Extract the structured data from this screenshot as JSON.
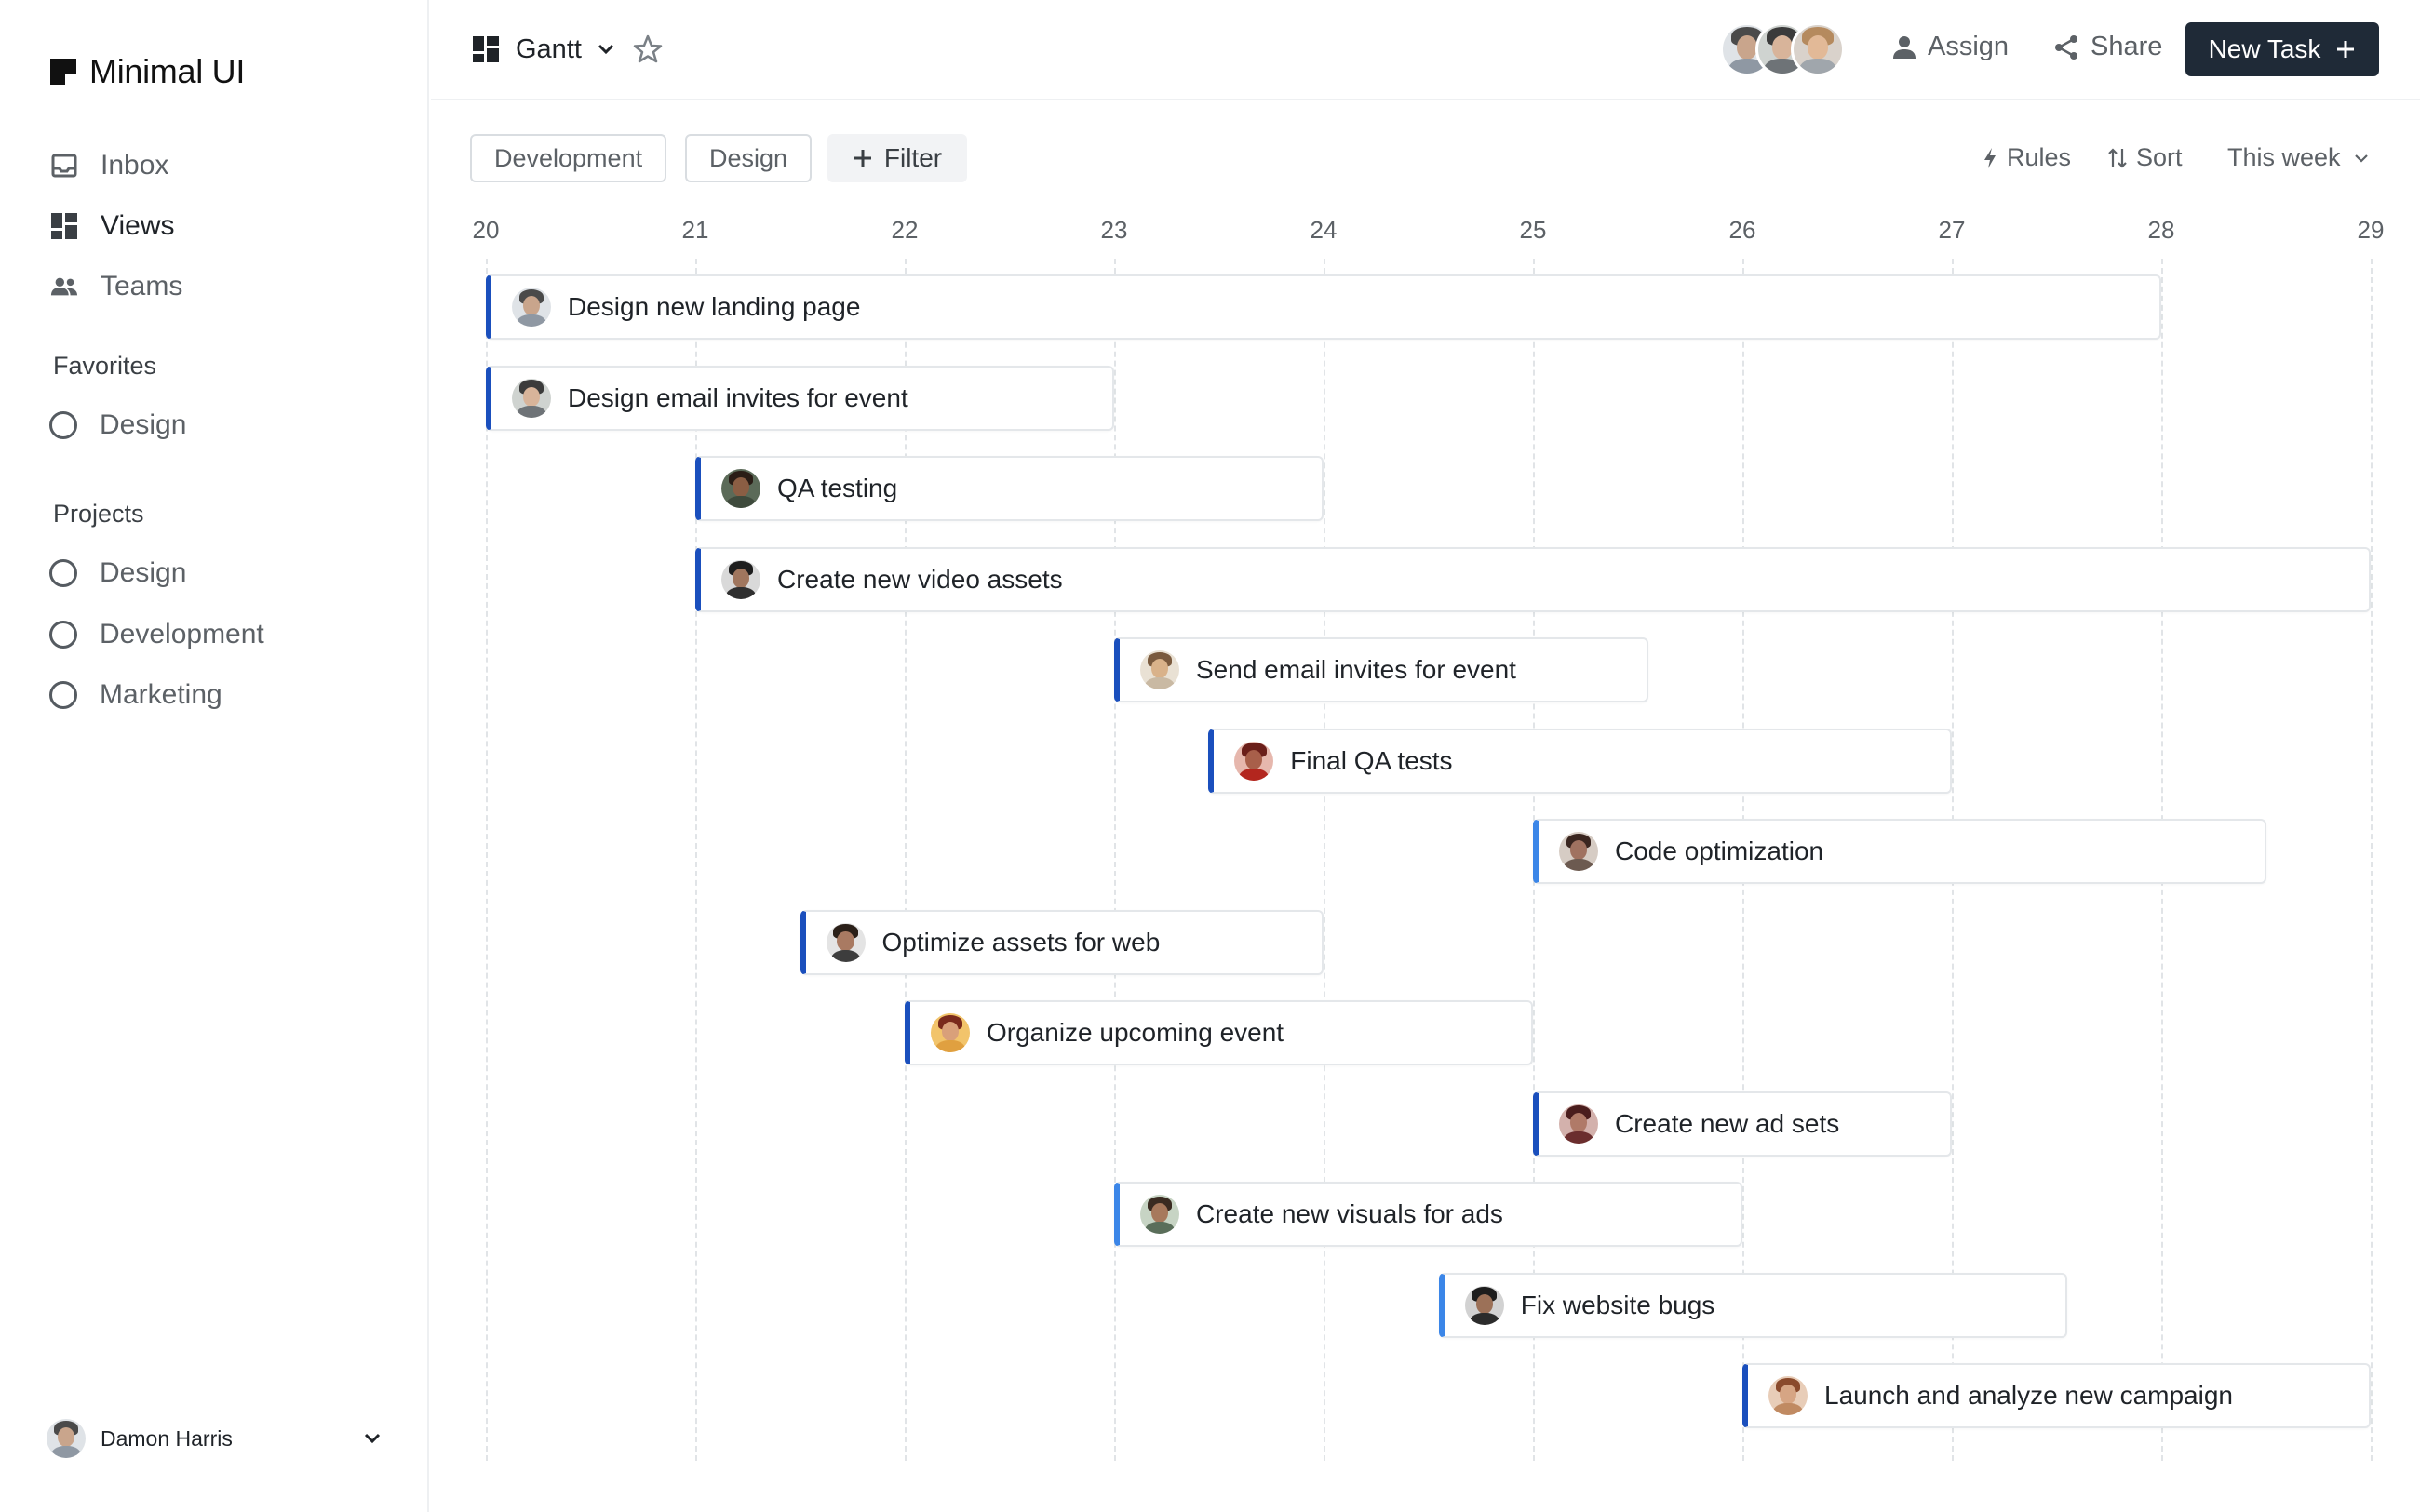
{
  "brand": {
    "name": "Minimal UI"
  },
  "nav": [
    {
      "label": "Inbox",
      "icon": "inbox-icon"
    },
    {
      "label": "Views",
      "icon": "grid-icon"
    },
    {
      "label": "Teams",
      "icon": "people-icon"
    }
  ],
  "favorites": {
    "title": "Favorites",
    "items": [
      {
        "label": "Design"
      }
    ]
  },
  "projects": {
    "title": "Projects",
    "items": [
      {
        "label": "Design"
      },
      {
        "label": "Development"
      },
      {
        "label": "Marketing"
      }
    ]
  },
  "user": {
    "name": "Damon Harris"
  },
  "header": {
    "view_label": "Gantt",
    "assign_label": "Assign",
    "share_label": "Share",
    "new_task_label": "New Task"
  },
  "filters": {
    "chips": [
      "Development",
      "Design"
    ],
    "filter_label": "Filter",
    "rules_label": "Rules",
    "sort_label": "Sort",
    "range_label": "This week"
  },
  "colors": {
    "accent_dark": "#1a4fbd",
    "accent_light": "#3b86e8",
    "button_bg": "#1f2a37"
  },
  "gantt": {
    "days": [
      "20",
      "21",
      "22",
      "23",
      "24",
      "25",
      "26",
      "27",
      "28",
      "29"
    ],
    "tasks": [
      {
        "label": "Design new landing page",
        "start": 0.0,
        "end": 8.0,
        "accent": "dark",
        "avatar": {
          "skin": "#c9a58c",
          "hair": "#4a4a4a",
          "shirt": "#8f98a3",
          "bg": "#dfe3e7"
        }
      },
      {
        "label": "Design email invites for event",
        "start": 0.0,
        "end": 3.0,
        "accent": "dark",
        "avatar": {
          "skin": "#d8b49a",
          "hair": "#3b3b3b",
          "shirt": "#6e7377",
          "bg": "#cfd3d0"
        }
      },
      {
        "label": "QA testing",
        "start": 1.0,
        "end": 4.0,
        "accent": "dark",
        "avatar": {
          "skin": "#8b5e44",
          "hair": "#2a1d16",
          "shirt": "#3e4a3c",
          "bg": "#5b6a58"
        }
      },
      {
        "label": "Create new video assets",
        "start": 1.0,
        "end": 9.0,
        "accent": "dark",
        "avatar": {
          "skin": "#a0765e",
          "hair": "#1e1e1e",
          "shirt": "#2f2f2f",
          "bg": "#d9d9d9"
        }
      },
      {
        "label": "Send email invites for event",
        "start": 3.0,
        "end": 5.55,
        "accent": "dark",
        "avatar": {
          "skin": "#d9b28a",
          "hair": "#7a5a3e",
          "shirt": "#c9b9a3",
          "bg": "#e9e1d4"
        }
      },
      {
        "label": "Final QA tests",
        "start": 3.45,
        "end": 7.0,
        "accent": "dark",
        "avatar": {
          "skin": "#a85f4a",
          "hair": "#6b1f1a",
          "shirt": "#b3261e",
          "bg": "#e6b7ad"
        }
      },
      {
        "label": "Code optimization",
        "start": 5.0,
        "end": 8.5,
        "accent": "light",
        "avatar": {
          "skin": "#a07260",
          "hair": "#3a2620",
          "shirt": "#6c5a50",
          "bg": "#d6ccc4"
        }
      },
      {
        "label": "Optimize assets for web",
        "start": 1.5,
        "end": 4.0,
        "accent": "dark",
        "avatar": {
          "skin": "#a97a62",
          "hair": "#2b2019",
          "shirt": "#3d3d3d",
          "bg": "#e4e4e4"
        }
      },
      {
        "label": "Organize upcoming event",
        "start": 2.0,
        "end": 5.0,
        "accent": "dark",
        "avatar": {
          "skin": "#d9a07a",
          "hair": "#7a2a1c",
          "shirt": "#e0a040",
          "bg": "#f2c46b"
        }
      },
      {
        "label": "Create new ad sets",
        "start": 5.0,
        "end": 7.0,
        "accent": "dark",
        "avatar": {
          "skin": "#b07a68",
          "hair": "#4a1d1d",
          "shirt": "#6b2e2e",
          "bg": "#d3b1ac"
        }
      },
      {
        "label": "Create new visuals for ads",
        "start": 3.0,
        "end": 6.0,
        "accent": "light",
        "avatar": {
          "skin": "#a7795c",
          "hair": "#3a2b21",
          "shirt": "#5a6e5a",
          "bg": "#c7d4c4"
        }
      },
      {
        "label": "Fix website bugs",
        "start": 4.55,
        "end": 7.55,
        "accent": "light",
        "avatar": {
          "skin": "#9c7158",
          "hair": "#1d1d1d",
          "shirt": "#2b2b2b",
          "bg": "#d2d2d2"
        }
      },
      {
        "label": "Launch and analyze new campaign",
        "start": 6.0,
        "end": 9.0,
        "accent": "dark",
        "avatar": {
          "skin": "#d6a584",
          "hair": "#8a4a2c",
          "shirt": "#c08a62",
          "bg": "#e8cdb8"
        }
      }
    ]
  }
}
